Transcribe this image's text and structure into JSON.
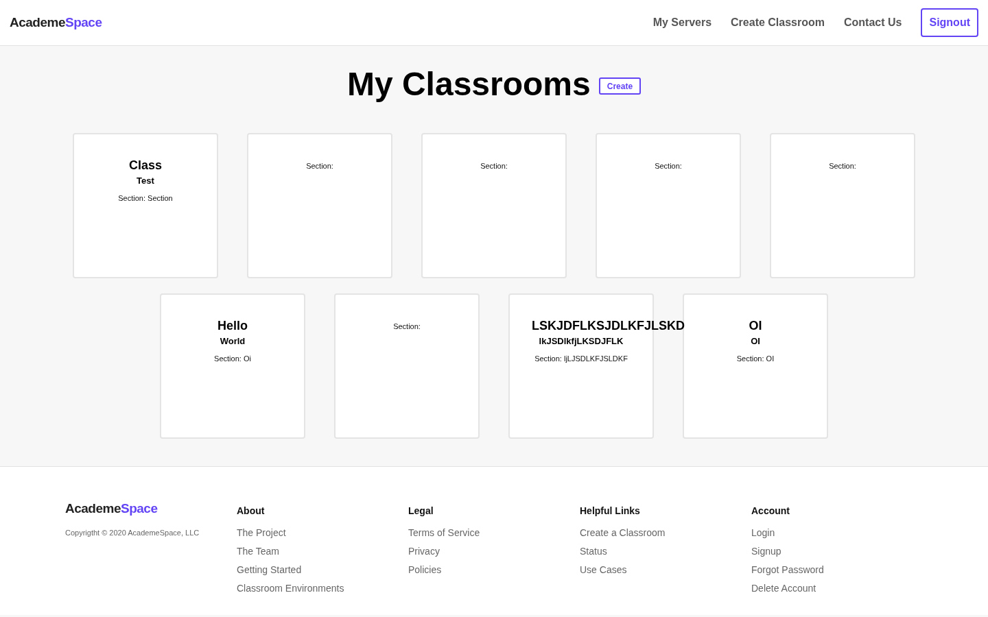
{
  "header": {
    "logo": {
      "first": "Academe",
      "second": "Space"
    },
    "nav": [
      "My Servers",
      "Create Classroom",
      "Contact Us"
    ],
    "signout": "Signout"
  },
  "page": {
    "title": "My Classrooms",
    "create_button": "Create"
  },
  "classrooms": [
    {
      "title": "Class",
      "subtitle": "Test",
      "section": "Section: Section"
    },
    {
      "section": "Section:"
    },
    {
      "section": "Section:"
    },
    {
      "section": "Section:"
    },
    {
      "section": "Section:"
    },
    {
      "title": "Hello",
      "subtitle": "World",
      "section": "Section: Oi"
    },
    {
      "section": "Section:"
    },
    {
      "title": "LSKJDFLKSJDLKFJLSKD",
      "subtitle": "lkJSDlkfjLKSDJFLK",
      "section": "Section: ljLJSDLKFJSLDKF"
    },
    {
      "title": "OI",
      "subtitle": "OI",
      "section": "Section: OI"
    }
  ],
  "footer": {
    "logo": {
      "first": "Academe",
      "second": "Space"
    },
    "copyright": "Copyrigtht © 2020 AcademeSpace, LLC",
    "columns": [
      {
        "heading": "About",
        "links": [
          "The Project",
          "The Team",
          "Getting Started",
          "Classroom Environments"
        ]
      },
      {
        "heading": "Legal",
        "links": [
          "Terms of Service",
          "Privacy",
          "Policies"
        ]
      },
      {
        "heading": "Helpful Links",
        "links": [
          "Create a Classroom",
          "Status",
          "Use Cases"
        ]
      },
      {
        "heading": "Account",
        "links": [
          "Login",
          "Signup",
          "Forgot Password",
          "Delete Account"
        ]
      }
    ]
  }
}
